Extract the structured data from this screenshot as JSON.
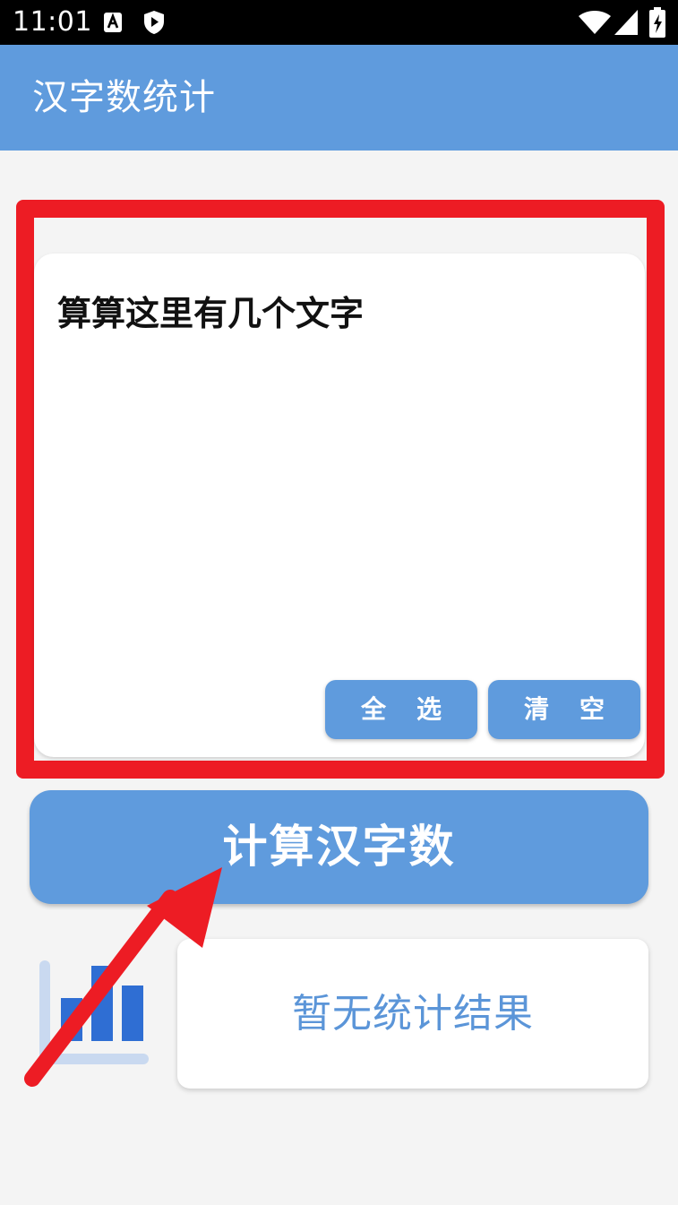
{
  "status_bar": {
    "time": "11:01",
    "icons": [
      "a-icon",
      "shield-play-icon",
      "wifi-icon",
      "signal-icon",
      "battery-icon"
    ]
  },
  "app_bar": {
    "title": "汉字数统计"
  },
  "input": {
    "text": "算算这里有几个文字"
  },
  "buttons": {
    "select_all": "全选",
    "clear": "清空",
    "calculate": "计算汉字数"
  },
  "result": {
    "text": "暂无统计结果"
  },
  "colors": {
    "accent": "#5f9bdd",
    "highlight": "#ed1c24",
    "result_text": "#5b95d8",
    "background": "#f4f4f4"
  }
}
